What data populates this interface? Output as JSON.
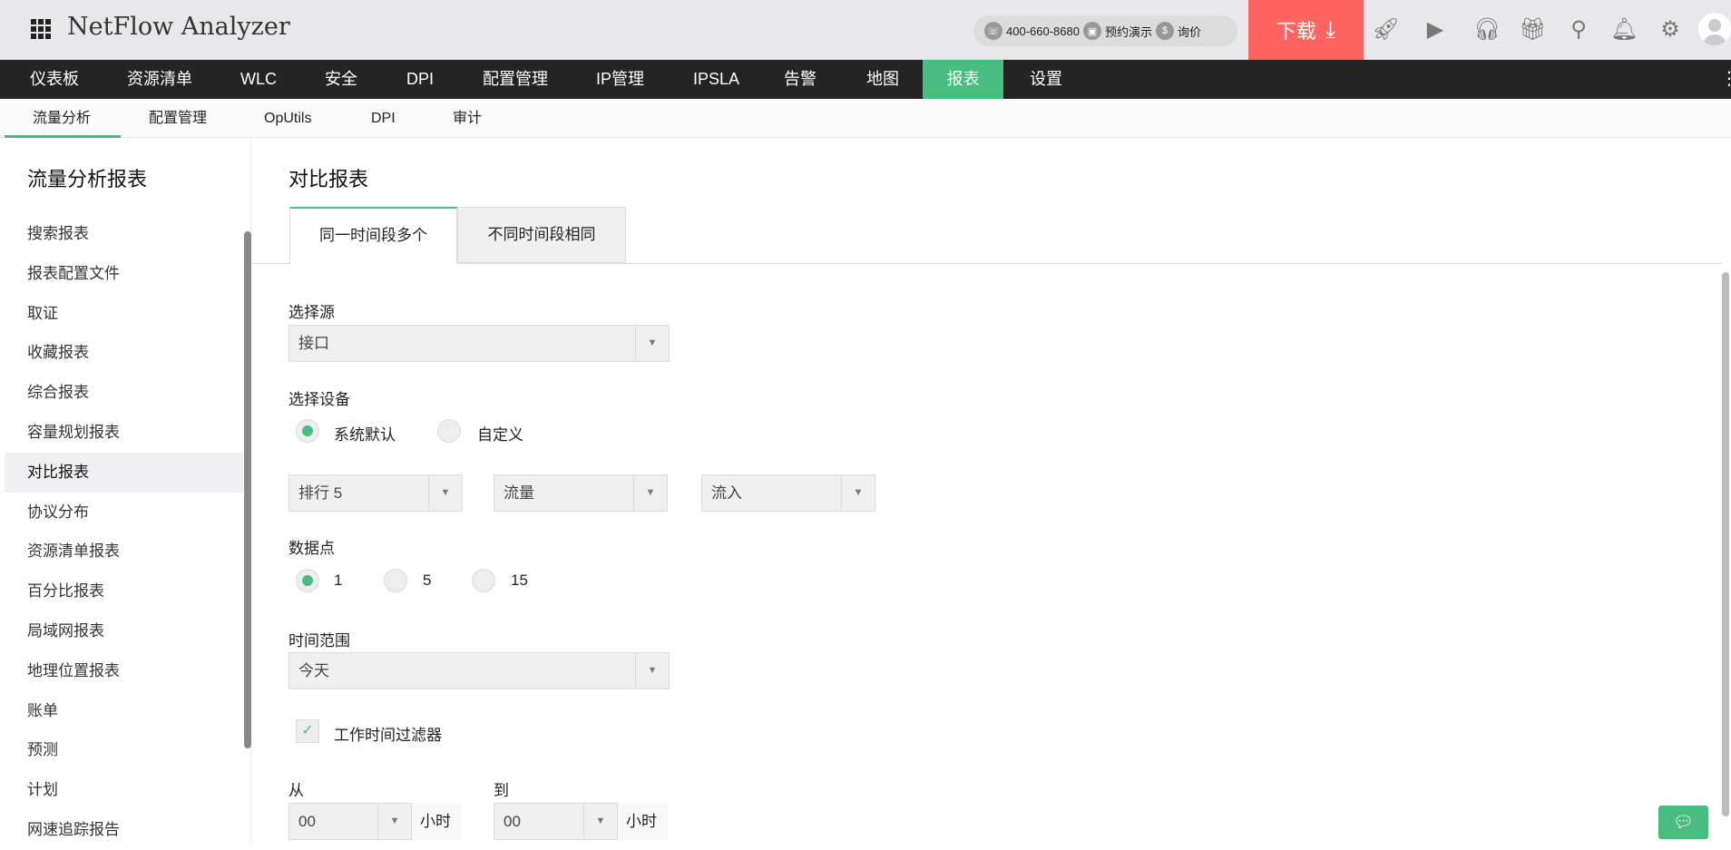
{
  "header": {
    "title": "NetFlow Analyzer",
    "phone": "400-660-8680",
    "demo": "预约演示",
    "price": "询价",
    "download": "下载"
  },
  "nav": [
    "仪表板",
    "资源清单",
    "WLC",
    "安全",
    "DPI",
    "配置管理",
    "IP管理",
    "IPSLA",
    "告警",
    "地图",
    "报表",
    "设置"
  ],
  "subnav": [
    "流量分析",
    "配置管理",
    "OpUtils",
    "DPI",
    "审计"
  ],
  "sidebar": {
    "title": "流量分析报表",
    "items": [
      "搜索报表",
      "报表配置文件",
      "取证",
      "收藏报表",
      "综合报表",
      "容量规划报表",
      "对比报表",
      "协议分布",
      "资源清单报表",
      "百分比报表",
      "局域网报表",
      "地理位置报表",
      "账单",
      "预测",
      "计划",
      "网速追踪报告"
    ],
    "selected": "对比报表"
  },
  "main": {
    "title": "对比报表",
    "tabs": [
      "同一时间段多个",
      "不同时间段相同"
    ],
    "source": {
      "label": "选择源",
      "value": "接口"
    },
    "device": {
      "label": "选择设备",
      "options": [
        "系统默认",
        "自定义"
      ],
      "selected": "系统默认"
    },
    "filters": [
      "排行 5",
      "流量",
      "流入"
    ],
    "datapoints": {
      "label": "数据点",
      "options": [
        "1",
        "5",
        "15"
      ],
      "selected": "1"
    },
    "timerange": {
      "label": "时间范围",
      "value": "今天"
    },
    "workhours": {
      "label": "工作时间过滤器",
      "checked": true
    },
    "from": {
      "label": "从",
      "value": "00",
      "unit": "小时"
    },
    "to": {
      "label": "到",
      "value": "00",
      "unit": "小时"
    }
  },
  "colors": {
    "accent": "#47bd7f",
    "download": "#ff6460",
    "nav_bg": "#242424"
  }
}
